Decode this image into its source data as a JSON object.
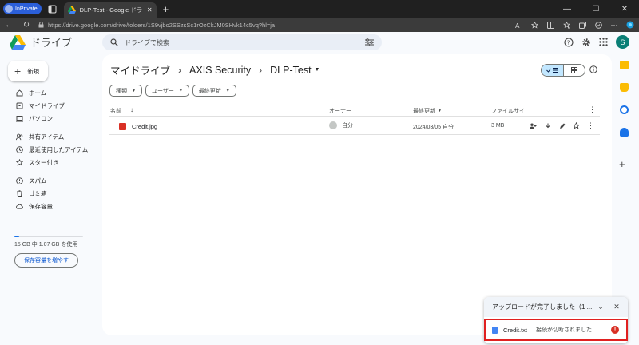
{
  "browser": {
    "inprivate_label": "InPrivate",
    "tab_title": "DLP-Test - Google ドライブ",
    "url": "https://drive.google.com/drive/folders/1S9vjbo2SSzsSc1rOzCkJM0SHvk14c5vq?hl=ja",
    "window_controls": [
      "—",
      "☐",
      "✕"
    ]
  },
  "app": {
    "product_name": "ドライブ",
    "search_placeholder": "ドライブで検索",
    "avatar_letter": "S"
  },
  "sidebar": {
    "new_label": "新規",
    "items": [
      {
        "label": "ホーム",
        "icon": "home-icon"
      },
      {
        "label": "マイドライブ",
        "icon": "my-drive-icon"
      },
      {
        "label": "パソコン",
        "icon": "computers-icon"
      },
      {
        "label": "共有アイテム",
        "icon": "shared-icon"
      },
      {
        "label": "最近使用したアイテム",
        "icon": "recent-icon"
      },
      {
        "label": "スター付き",
        "icon": "star-icon"
      },
      {
        "label": "スパム",
        "icon": "spam-icon"
      },
      {
        "label": "ゴミ箱",
        "icon": "trash-icon"
      },
      {
        "label": "保存容量",
        "icon": "cloud-icon"
      }
    ],
    "storage_text": "15 GB 中 1.07 GB を使用",
    "storage_fraction": 0.071,
    "buy_storage_label": "保存容量を増やす"
  },
  "main": {
    "breadcrumbs": [
      "マイドライブ",
      "AXIS Security",
      "DLP-Test"
    ],
    "filters": [
      "種類",
      "ユーザー",
      "最終更新"
    ],
    "columns": {
      "name": "名前",
      "owner": "オーナー",
      "modified": "最終更新",
      "size": "ファイルサイ"
    },
    "rows": [
      {
        "name": "Credit.jpg",
        "owner": "自分",
        "modified": "2024/03/05 自分",
        "size": "3 MB"
      }
    ]
  },
  "upload_panel": {
    "title": "アップロードが完了しました（1 ...",
    "file_name": "Credit.txt",
    "status": "接続が切断されました",
    "error_symbol": "!"
  },
  "colors": {
    "accent": "#0b57d0",
    "selected": "#c2e7ff",
    "error": "#d93025",
    "highlight_border": "#e02020"
  }
}
